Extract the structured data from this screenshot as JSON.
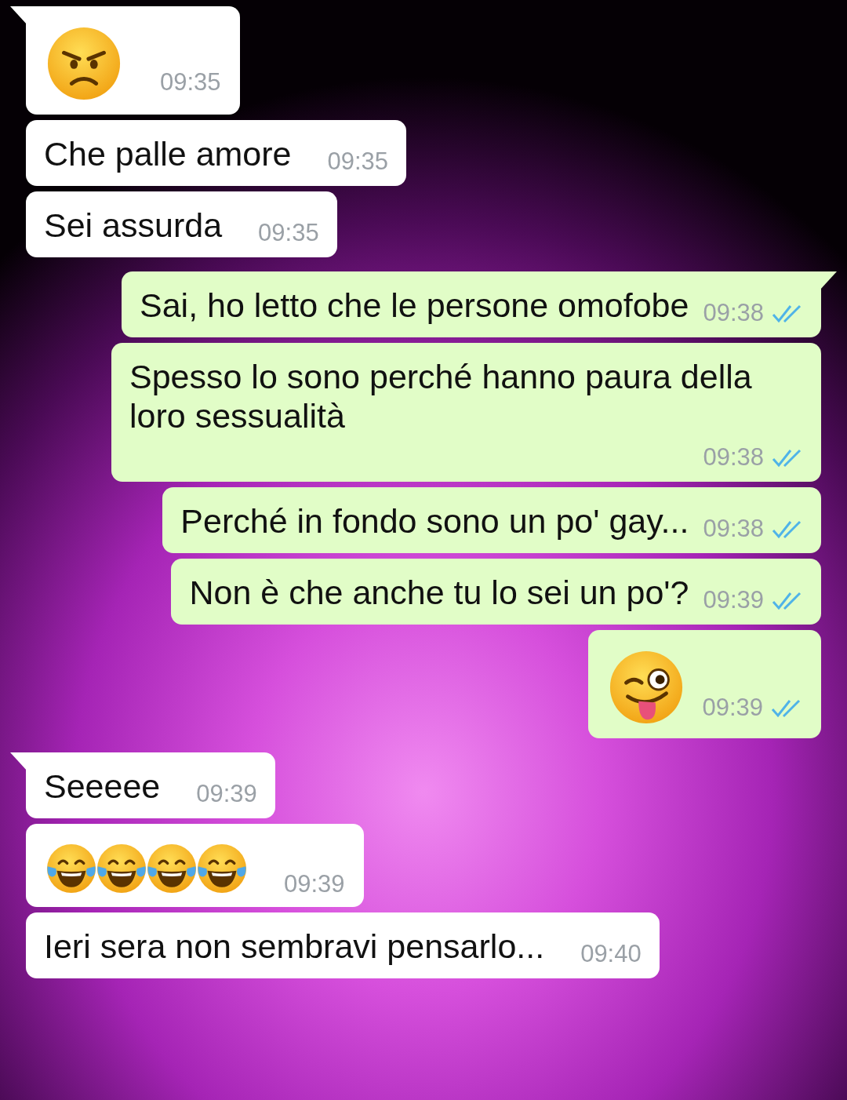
{
  "messages": [
    {
      "kind": "incoming",
      "tail": true,
      "emojis": [
        {
          "kind": "angry"
        }
      ],
      "time": "09:35"
    },
    {
      "kind": "incoming",
      "tail": false,
      "text": "Che palle amore",
      "time": "09:35"
    },
    {
      "kind": "incoming",
      "tail": false,
      "text": "Sei assurda",
      "time": "09:35"
    },
    {
      "kind": "outgoing",
      "tail": true,
      "text": "Sai, ho letto che le persone omofobe",
      "time": "09:38",
      "read": true
    },
    {
      "kind": "outgoing",
      "tail": false,
      "text": "Spesso lo sono perché hanno paura della loro sessualità",
      "time": "09:38",
      "read": true
    },
    {
      "kind": "outgoing",
      "tail": false,
      "text": "Perché in fondo sono un po' gay...",
      "time": "09:38",
      "read": true
    },
    {
      "kind": "outgoing",
      "tail": false,
      "text": "Non è che anche tu lo sei un po'?",
      "time": "09:39",
      "read": true
    },
    {
      "kind": "outgoing",
      "tail": false,
      "emojis": [
        {
          "kind": "wink"
        }
      ],
      "time": "09:39",
      "read": true
    },
    {
      "kind": "incoming",
      "tail": true,
      "text": "Seeeee",
      "time": "09:39"
    },
    {
      "kind": "incoming",
      "tail": false,
      "emojis": [
        {
          "kind": "laugh"
        },
        {
          "kind": "laugh"
        },
        {
          "kind": "laugh"
        },
        {
          "kind": "laugh"
        }
      ],
      "time": "09:39"
    },
    {
      "kind": "incoming",
      "tail": false,
      "text": "Ieri sera non sembravi pensarlo...",
      "time": "09:40"
    }
  ]
}
